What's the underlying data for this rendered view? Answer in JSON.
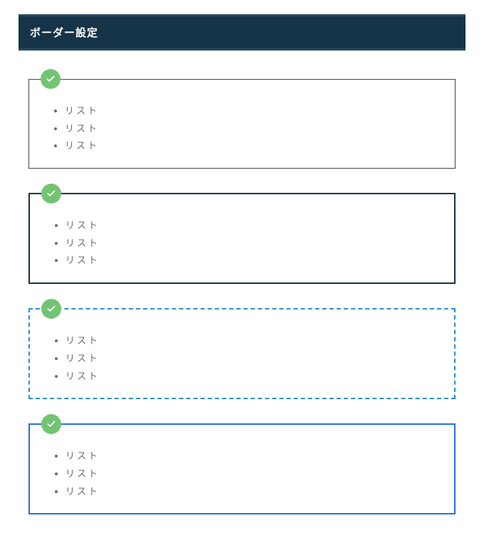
{
  "header": {
    "title": "ボーダー設定"
  },
  "boxes": [
    {
      "style": "thin",
      "items": [
        "リスト",
        "リスト",
        "リスト"
      ]
    },
    {
      "style": "thick",
      "items": [
        "リスト",
        "リスト",
        "リスト"
      ]
    },
    {
      "style": "dash",
      "items": [
        "リスト",
        "リスト",
        "リスト"
      ]
    },
    {
      "style": "blue",
      "items": [
        "リスト",
        "リスト",
        "リスト"
      ]
    }
  ],
  "icons": {
    "check": "check-icon"
  }
}
